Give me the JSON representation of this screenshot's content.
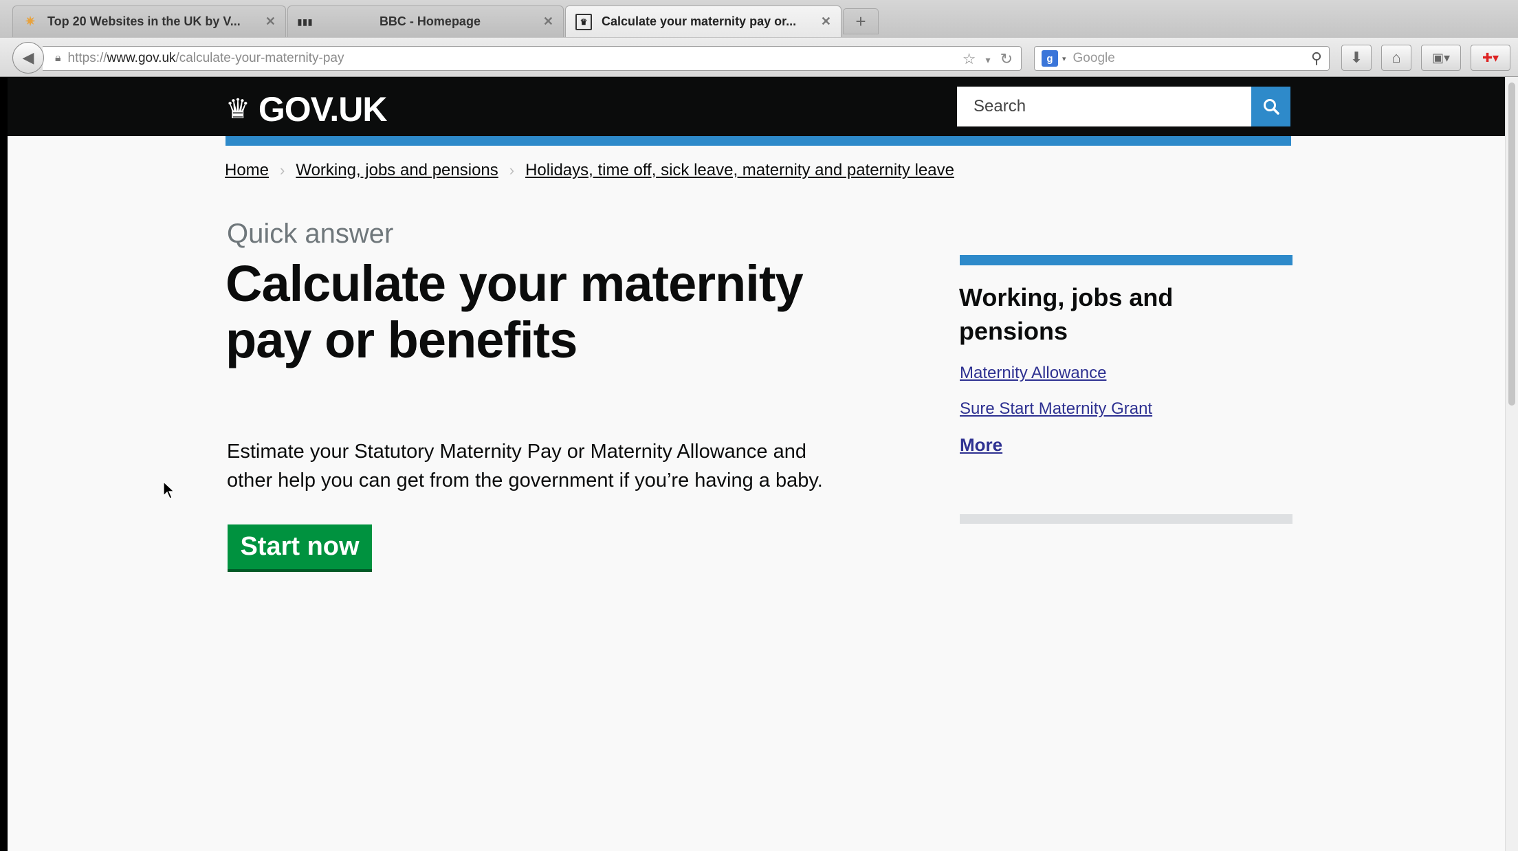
{
  "browser": {
    "tabs": [
      {
        "title": "Top 20 Websites in the UK by V...",
        "icon": "star-favicon-icon",
        "active": false
      },
      {
        "title": "BBC - Homepage",
        "icon": "bbc-favicon-icon",
        "active": false
      },
      {
        "title": "Calculate your maternity pay or...",
        "icon": "crown-favicon-icon",
        "active": true
      }
    ],
    "url_scheme": "https://",
    "url_host": "www.gov.uk",
    "url_path": "/calculate-your-maternity-pay",
    "search_engine_placeholder": "Google"
  },
  "header": {
    "logo_text": "GOV.UK",
    "search_placeholder": "Search"
  },
  "breadcrumb": [
    "Home",
    "Working, jobs and pensions",
    "Holidays, time off, sick leave, maternity and paternity leave"
  ],
  "main": {
    "kicker": "Quick answer",
    "title": "Calculate your maternity pay or benefits",
    "intro": "Estimate your Statutory Maternity Pay or Maternity Allowance and other help you can get from the government if you’re having a baby.",
    "start_button": "Start now"
  },
  "sidebar": {
    "heading": "Working, jobs and pensions",
    "links": [
      "Maternity Allowance",
      "Sure Start Maternity Grant"
    ],
    "more": "More"
  },
  "colors": {
    "brand_black": "#0b0c0c",
    "accent_blue": "#2e8aca",
    "button_green": "#00923f",
    "link": "#2e3191"
  }
}
